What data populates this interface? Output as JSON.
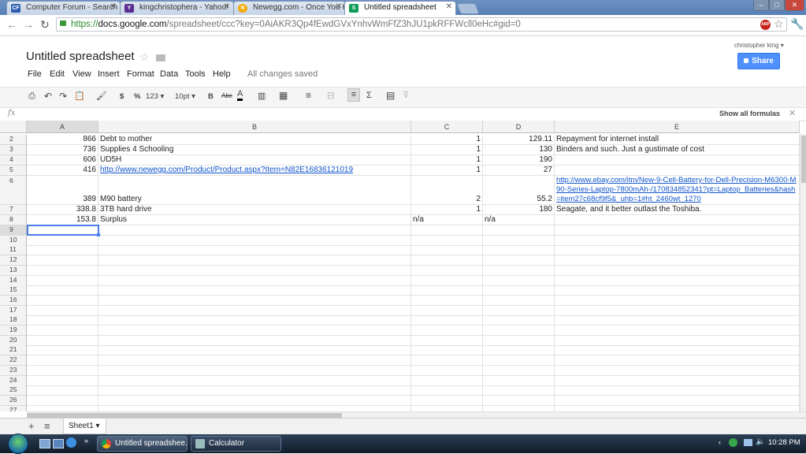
{
  "browser": {
    "tabs": [
      {
        "label": "Computer Forum - Search",
        "icon": "CF",
        "color": "#2a5db0"
      },
      {
        "label": "kingchristophera - Yahoo!",
        "icon": "Y",
        "color": "#5c2d91"
      },
      {
        "label": "Newegg.com - Once You K",
        "icon": "N",
        "color": "#f2a900"
      },
      {
        "label": "Untitled spreadsheet",
        "icon": "S",
        "color": "#0f9d58"
      }
    ],
    "url_scheme": "https://",
    "url_domain": "docs.google.com",
    "url_rest": "/spreadsheet/ccc?key=0AiAKR3Qp4fEwdGVxYnhvWmFfZ3hJU1pkRFFWcll0eHc#gid=0"
  },
  "doc": {
    "title": "Untitled spreadsheet",
    "menus": [
      "File",
      "Edit",
      "View",
      "Insert",
      "Format",
      "Data",
      "Tools",
      "Help"
    ],
    "save_status": "All changes saved",
    "user": "christopher king ▾",
    "share_label": "Share"
  },
  "toolbar": {
    "currency": "$",
    "percent": "%",
    "number_format": "123 ▾",
    "font_size": "10pt ▾",
    "bold": "B",
    "strike": "Abc",
    "text_color": "A",
    "sum": "Σ"
  },
  "formula_bar": {
    "fx": "fx",
    "show_all_formulas": "Show all formulas"
  },
  "grid": {
    "columns": [
      "A",
      "B",
      "C",
      "D",
      "E"
    ],
    "rows": [
      {
        "n": "2",
        "a": "866",
        "b": "Debt to mother",
        "c": "1",
        "d": "129.11",
        "e": "Repayment for internet install"
      },
      {
        "n": "3",
        "a": "736",
        "b": "Supplies 4 Schooling",
        "c": "1",
        "d": "130",
        "e": "Binders and such. Just a gustimate of cost"
      },
      {
        "n": "4",
        "a": "606",
        "b": "UD5H",
        "c": "1",
        "d": "190",
        "e": ""
      },
      {
        "n": "5",
        "a": "416",
        "b": "http://www.newegg.com/Product/Product.aspx?Item=N82E16836121019",
        "c": "1",
        "d": "27",
        "e": ""
      },
      {
        "n": "6",
        "a": "389",
        "b": "M90 battery",
        "c": "2",
        "d": "55.2",
        "e": "http://www.ebay.com/itm/New-9-Cell-Battery-for-Dell-Precision-M6300-M90-Series-Laptop-7800mAh-/170834852341?pt=Laptop_Batteries&hash=item27c68cf9f5&_uhb=1#ht_2460wt_1270"
      },
      {
        "n": "7",
        "a": "338.8",
        "b": "3TB hard drive",
        "c": "1",
        "d": "180",
        "e": "Seagate, and it better outlast the Toshiba."
      },
      {
        "n": "8",
        "a": "153.8",
        "b": "Surplus",
        "c": "n/a",
        "d": "n/a",
        "e": ""
      }
    ],
    "empty_rows": [
      "9",
      "10",
      "11",
      "12",
      "13",
      "14",
      "15",
      "16",
      "17",
      "18",
      "19",
      "20",
      "21",
      "22",
      "23",
      "24",
      "25",
      "26",
      "27"
    ]
  },
  "sheets": {
    "add": "+",
    "list": "≡",
    "active_sheet": "Sheet1 ▾"
  },
  "taskbar": {
    "items": [
      {
        "label": "Untitled spreadshee...",
        "active": true
      },
      {
        "label": "Calculator",
        "active": false
      }
    ],
    "clock": "10:28 PM"
  }
}
